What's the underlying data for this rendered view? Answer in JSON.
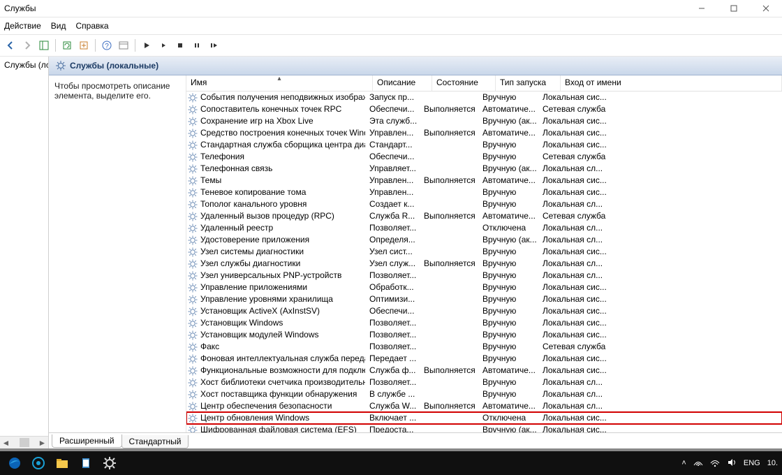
{
  "title": "Службы",
  "menu": {
    "action": "Действие",
    "view": "Вид",
    "help": "Справка"
  },
  "nav": {
    "item": "Службы (локальные)"
  },
  "heading": "Службы (локальные)",
  "desc_pane": "Чтобы просмотреть описание элемента, выделите его.",
  "columns": {
    "name": "Имя",
    "desc": "Описание",
    "state": "Состояние",
    "startup": "Тип запуска",
    "logon": "Вход от имени"
  },
  "tabs": {
    "ext": "Расширенный",
    "std": "Стандартный"
  },
  "systray": {
    "lang": "ENG",
    "time": "10."
  },
  "highlight_index": 27,
  "services": [
    {
      "name": "События получения неподвижных изображений",
      "desc": "Запуск пр...",
      "state": "",
      "startup": "Вручную",
      "logon": "Локальная сис..."
    },
    {
      "name": "Сопоставитель конечных точек RPC",
      "desc": "Обеспечи...",
      "state": "Выполняется",
      "startup": "Автоматиче...",
      "logon": "Сетевая служба"
    },
    {
      "name": "Сохранение игр на Xbox Live",
      "desc": "Эта служб...",
      "state": "",
      "startup": "Вручную (ак...",
      "logon": "Локальная сис..."
    },
    {
      "name": "Средство построения конечных точек Window...",
      "desc": "Управлен...",
      "state": "Выполняется",
      "startup": "Автоматиче...",
      "logon": "Локальная сис..."
    },
    {
      "name": "Стандартная служба сборщика центра диагно...",
      "desc": "Стандарт...",
      "state": "",
      "startup": "Вручную",
      "logon": "Локальная сис..."
    },
    {
      "name": "Телефония",
      "desc": "Обеспечи...",
      "state": "",
      "startup": "Вручную",
      "logon": "Сетевая служба"
    },
    {
      "name": "Телефонная связь",
      "desc": "Управляет...",
      "state": "",
      "startup": "Вручную (ак...",
      "logon": "Локальная сл..."
    },
    {
      "name": "Темы",
      "desc": "Управлен...",
      "state": "Выполняется",
      "startup": "Автоматиче...",
      "logon": "Локальная сис..."
    },
    {
      "name": "Теневое копирование тома",
      "desc": "Управлен...",
      "state": "",
      "startup": "Вручную",
      "logon": "Локальная сис..."
    },
    {
      "name": "Тополог канального уровня",
      "desc": "Создает к...",
      "state": "",
      "startup": "Вручную",
      "logon": "Локальная сл..."
    },
    {
      "name": "Удаленный вызов процедур (RPC)",
      "desc": "Служба R...",
      "state": "Выполняется",
      "startup": "Автоматиче...",
      "logon": "Сетевая служба"
    },
    {
      "name": "Удаленный реестр",
      "desc": "Позволяет...",
      "state": "",
      "startup": "Отключена",
      "logon": "Локальная сл..."
    },
    {
      "name": "Удостоверение приложения",
      "desc": "Определя...",
      "state": "",
      "startup": "Вручную (ак...",
      "logon": "Локальная сл..."
    },
    {
      "name": "Узел системы диагностики",
      "desc": "Узел сист...",
      "state": "",
      "startup": "Вручную",
      "logon": "Локальная сис..."
    },
    {
      "name": "Узел службы диагностики",
      "desc": "Узел служ...",
      "state": "Выполняется",
      "startup": "Вручную",
      "logon": "Локальная сл..."
    },
    {
      "name": "Узел универсальных PNP-устройств",
      "desc": "Позволяет...",
      "state": "",
      "startup": "Вручную",
      "logon": "Локальная сл..."
    },
    {
      "name": "Управление приложениями",
      "desc": "Обработк...",
      "state": "",
      "startup": "Вручную",
      "logon": "Локальная сис..."
    },
    {
      "name": "Управление уровнями хранилища",
      "desc": "Оптимизи...",
      "state": "",
      "startup": "Вручную",
      "logon": "Локальная сис..."
    },
    {
      "name": "Установщик ActiveX (AxInstSV)",
      "desc": "Обеспечи...",
      "state": "",
      "startup": "Вручную",
      "logon": "Локальная сис..."
    },
    {
      "name": "Установщик Windows",
      "desc": "Позволяет...",
      "state": "",
      "startup": "Вручную",
      "logon": "Локальная сис..."
    },
    {
      "name": "Установщик модулей Windows",
      "desc": "Позволяет...",
      "state": "",
      "startup": "Вручную",
      "logon": "Локальная сис..."
    },
    {
      "name": "Факс",
      "desc": "Позволяет...",
      "state": "",
      "startup": "Вручную",
      "logon": "Сетевая служба"
    },
    {
      "name": "Фоновая интеллектуальная служба передачи (...",
      "desc": "Передает ...",
      "state": "",
      "startup": "Вручную",
      "logon": "Локальная сис..."
    },
    {
      "name": "Функциональные возможности для подключе...",
      "desc": "Служба ф...",
      "state": "Выполняется",
      "startup": "Автоматиче...",
      "logon": "Локальная сис..."
    },
    {
      "name": "Хост библиотеки счетчика производительности",
      "desc": "Позволяет...",
      "state": "",
      "startup": "Вручную",
      "logon": "Локальная сл..."
    },
    {
      "name": "Хост поставщика функции обнаружения",
      "desc": "В службе ...",
      "state": "",
      "startup": "Вручную",
      "logon": "Локальная сл..."
    },
    {
      "name": "Центр обеспечения безопасности",
      "desc": "Служба W...",
      "state": "Выполняется",
      "startup": "Автоматиче...",
      "logon": "Локальная сл..."
    },
    {
      "name": "Центр обновления Windows",
      "desc": "Включает ...",
      "state": "",
      "startup": "Отключена",
      "logon": "Локальная сис..."
    },
    {
      "name": "Шифрованная файловая система (EFS)",
      "desc": "Предоста...",
      "state": "",
      "startup": "Вручную (ак...",
      "logon": "Локальная сис..."
    }
  ]
}
